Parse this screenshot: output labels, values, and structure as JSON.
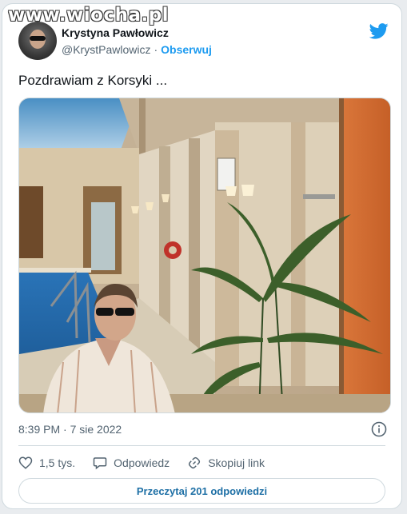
{
  "watermark": "www.wiocha.pl",
  "author": {
    "name": "Krystyna Pawłowicz",
    "handle": "@KrystPawlowicz",
    "separator": "·",
    "follow_label": "Obserwuj"
  },
  "tweet": {
    "text": "Pozdrawiam z Korsyki ..."
  },
  "meta": {
    "timestamp": "8:39 PM · 7 sie 2022"
  },
  "actions": {
    "likes": "1,5 tys.",
    "reply_label": "Odpowiedz",
    "copy_link_label": "Skopiuj link"
  },
  "read_replies_label": "Przeczytaj 201 odpowiedzi",
  "colors": {
    "accent": "#1d9bf0",
    "text": "#0f1419",
    "muted": "#536471",
    "border": "#cfd9de"
  },
  "icons": [
    "twitter-bird-icon",
    "info-icon",
    "heart-icon",
    "reply-bubble-icon",
    "link-icon"
  ]
}
